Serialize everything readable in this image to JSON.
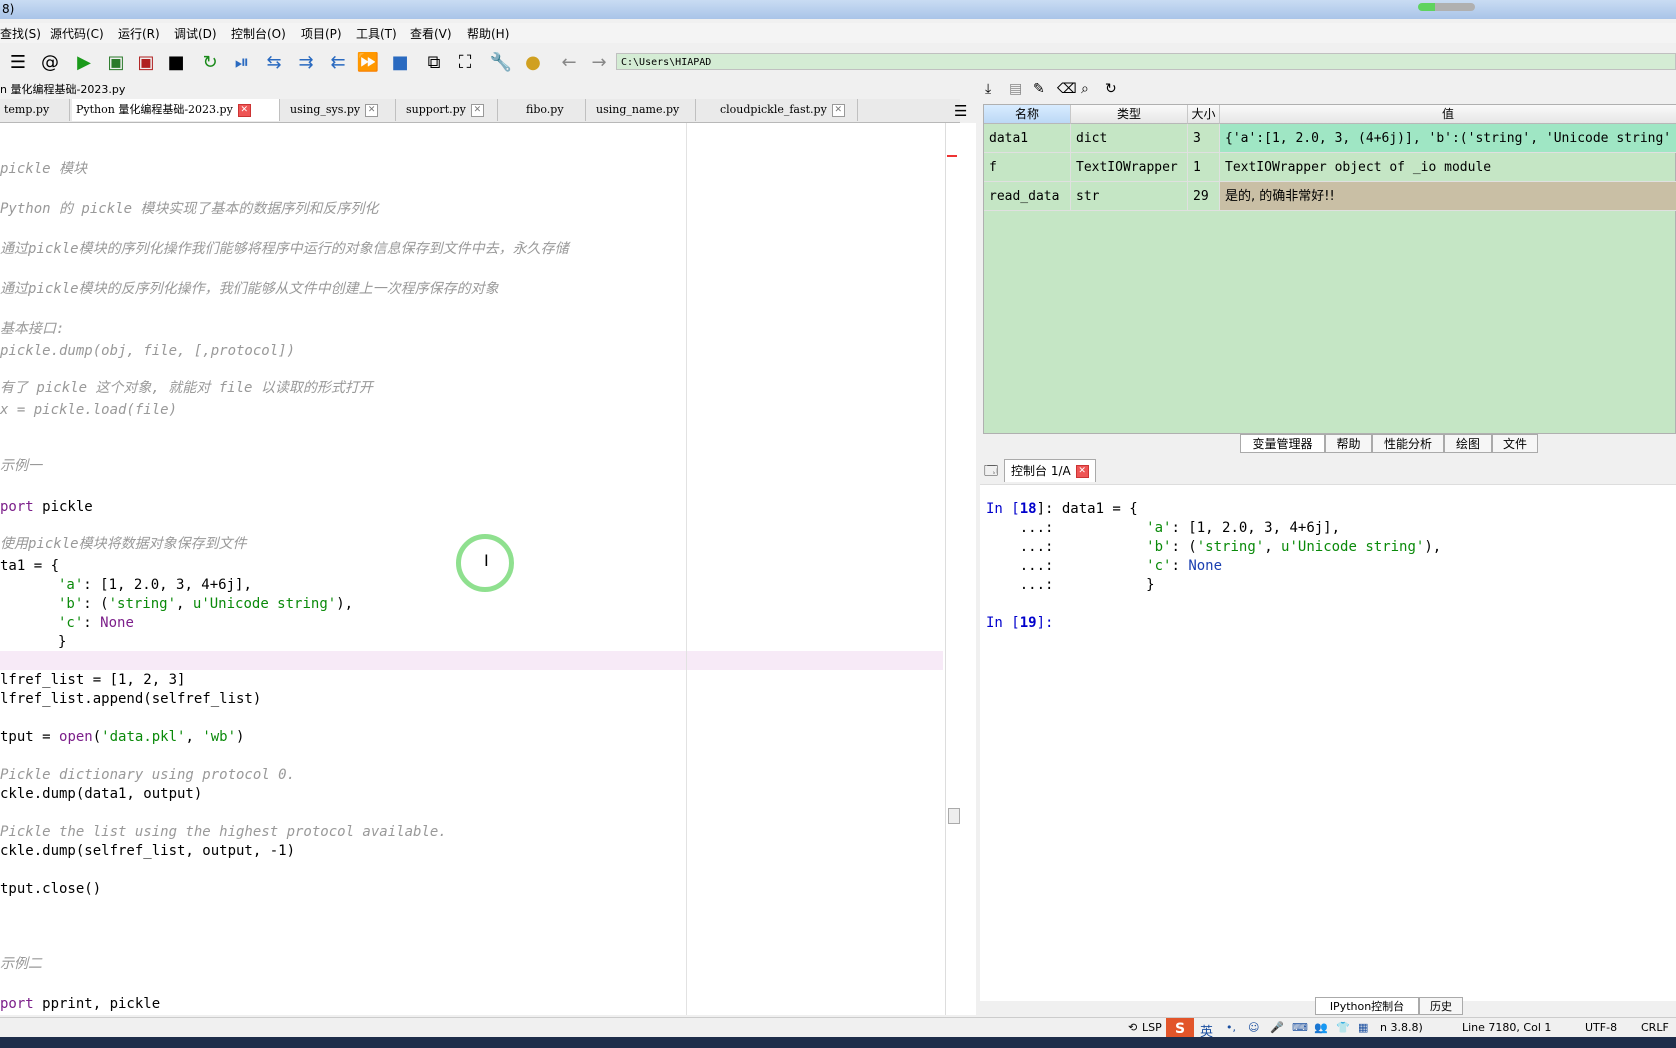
{
  "window": {
    "title_fragment": "8)"
  },
  "menu": [
    "查找(S)",
    "源代码(C)",
    "运行(R)",
    "调试(D)",
    "控制台(O)",
    "项目(P)",
    "工具(T)",
    "查看(V)",
    "帮助(H)"
  ],
  "toolbar": {
    "path": "C:\\Users\\HIAPAD",
    "icons": [
      "outline-icon",
      "at-icon",
      "run-icon",
      "run-cell-icon",
      "run-cell-advance-icon",
      "run-selection-icon",
      "rerun-icon",
      "debug-icon",
      "step-icon",
      "step-into-icon",
      "step-return-icon",
      "continue-icon",
      "stop-icon",
      "maximize-pane-icon",
      "fullscreen-icon",
      "wrench-icon",
      "python-path-icon",
      "back-arrow-icon",
      "forward-arrow-icon"
    ]
  },
  "editor": {
    "file_title": "n 量化编程基础-2023.py",
    "tabs": [
      {
        "label": "temp.py",
        "active": false
      },
      {
        "label": "Python 量化编程基础-2023.py",
        "active": true
      },
      {
        "label": "using_sys.py",
        "active": false
      },
      {
        "label": "support.py",
        "active": false
      },
      {
        "label": "fibo.py",
        "active": false
      },
      {
        "label": "using_name.py",
        "active": false
      },
      {
        "label": "cloudpickle_fast.py",
        "active": false
      }
    ],
    "lines": {
      "l1": "pickle 模块",
      "l2": "Python 的 pickle 模块实现了基本的数据序列和反序列化",
      "l3": "通过pickle模块的序列化操作我们能够将程序中运行的对象信息保存到文件中去，永久存储",
      "l4": "通过pickle模块的反序列化操作，我们能够从文件中创建上一次程序保存的对象",
      "l5": "基本接口:",
      "l6": "pickle.dump(obj, file, [,protocol])",
      "l7": "有了 pickle 这个对象, 就能对 file 以读取的形式打开",
      "l8": "x = pickle.load(file)",
      "l9": "示例一",
      "l10a": "port",
      "l10b": " pickle",
      "l11": "使用pickle模块将数据对象保存到文件",
      "l12": "ta1 = {",
      "l13a": "'a'",
      "l13b": ": [1, 2.0, 3, 4+6j],",
      "l14a": "'b'",
      "l14b": ": (",
      "l14c": "'string'",
      "l14d": ", ",
      "l14e": "u'Unicode string'",
      "l14f": "),",
      "l15a": "'c'",
      "l15b": ": ",
      "l15c": "None",
      "l16": "}",
      "l17": "lfref_list = [1, 2, 3]",
      "l18": "lfref_list.append(selfref_list)",
      "l19a": "tput = ",
      "l19b": "open",
      "l19c": "(",
      "l19d": "'data.pkl'",
      "l19e": ", ",
      "l19f": "'wb'",
      "l19g": ")",
      "l20": "Pickle dictionary using protocol 0.",
      "l21": "ckle.dump(data1, output)",
      "l22": "Pickle the list using the highest protocol available.",
      "l23": "ckle.dump(selfref_list, output, -1)",
      "l24": "tput.close()",
      "l25": "示例二",
      "l26a": "port",
      "l26b": " pprint, pickle"
    }
  },
  "variable_explorer": {
    "icons": [
      "import-data-icon",
      "save-data-icon",
      "save-as-icon",
      "erase-icon",
      "search-icon",
      "refresh-icon"
    ],
    "headers": [
      "名称",
      "类型",
      "大小",
      "值"
    ],
    "rows": [
      {
        "name": "data1",
        "type": "dict",
        "size": "3",
        "value": "{'a':[1, 2.0, 3, (4+6j)], 'b':('string', 'Unicode string'"
      },
      {
        "name": "f",
        "type": "TextIOWrapper",
        "size": "1",
        "value": "TextIOWrapper object of _io module"
      },
      {
        "name": "read_data",
        "type": "str",
        "size": "29",
        "value": "是的, 的确非常好!!"
      }
    ],
    "pane_tabs": [
      "变量管理器",
      "帮助",
      "性能分析",
      "绘图",
      "文件"
    ]
  },
  "console": {
    "tab_label": "控制台 1/A",
    "in18_pre": "In [",
    "in18_num": "18",
    "in18_post": "]: data1 = {",
    "c2a": "    ...:           ",
    "c2b": "'a'",
    "c2c": ": [1, 2.0, 3, 4+6j],",
    "c3a": "    ...:           ",
    "c3b": "'b'",
    "c3c": ": (",
    "c3d": "'string'",
    "c3e": ", ",
    "c3f": "u'Unicode string'",
    "c3g": "),",
    "c4a": "    ...:           ",
    "c4b": "'c'",
    "c4c": ": ",
    "c4d": "None",
    "c5": "    ...:           }",
    "in19_pre": "In [",
    "in19_num": "19",
    "in19_post": "]:",
    "bottom_tabs": [
      "IPython控制台",
      "历史"
    ]
  },
  "status": {
    "lsp": "LSP",
    "ime": "英",
    "python": "n 3.8.8)",
    "position": "Line 7180, Col 1",
    "encoding": "UTF-8",
    "eol": "CRLF"
  }
}
